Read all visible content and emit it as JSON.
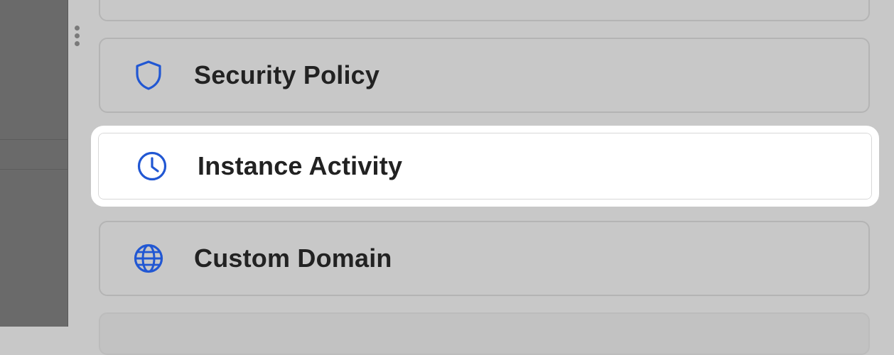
{
  "colors": {
    "accent": "#2157d3",
    "text": "#222222",
    "background": "#c8c8c8",
    "active_background": "#ffffff"
  },
  "menu": {
    "items": [
      {
        "label": "Security Policy",
        "icon": "shield-icon",
        "active": false
      },
      {
        "label": "Instance Activity",
        "icon": "clock-icon",
        "active": true
      },
      {
        "label": "Custom Domain",
        "icon": "globe-icon",
        "active": false
      }
    ]
  }
}
